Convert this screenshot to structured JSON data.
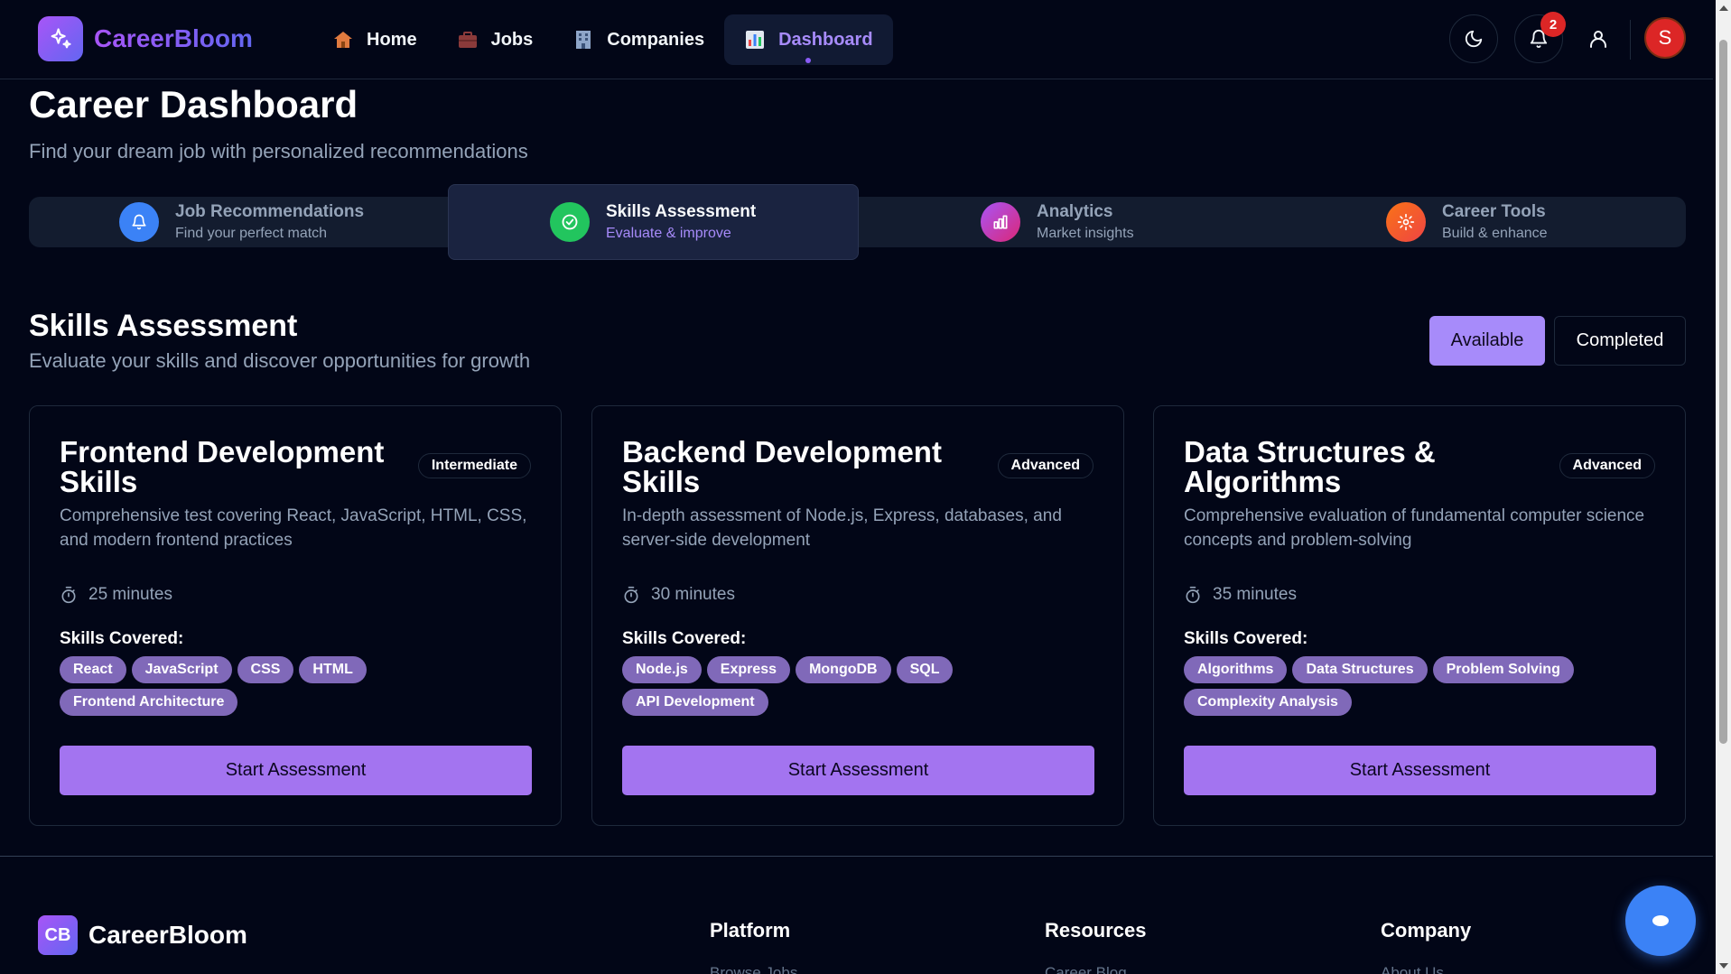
{
  "brand": {
    "name": "CareerBloom",
    "footer_initials": "CB"
  },
  "nav": {
    "links": [
      {
        "label": "Home",
        "icon": "house-emoji-icon"
      },
      {
        "label": "Jobs",
        "icon": "briefcase-emoji-icon"
      },
      {
        "label": "Companies",
        "icon": "office-building-emoji-icon"
      },
      {
        "label": "Dashboard",
        "icon": "bar-chart-emoji-icon",
        "active": true
      }
    ],
    "notification_count": "2",
    "avatar_initial": "S"
  },
  "header": {
    "title": "Career Dashboard",
    "subtitle": "Find your dream job with personalized recommendations"
  },
  "tabs": [
    {
      "title": "Job Recommendations",
      "desc": "Find your perfect match",
      "icon": "bell-icon",
      "color": "#3b82f6"
    },
    {
      "title": "Skills Assessment",
      "desc": "Evaluate & improve",
      "icon": "check-circle-icon",
      "color": "#22c55e",
      "active": true
    },
    {
      "title": "Analytics",
      "desc": "Market insights",
      "icon": "bar-chart-icon",
      "color": "#c026d3"
    },
    {
      "title": "Career Tools",
      "desc": "Build & enhance",
      "icon": "gear-icon",
      "color": "#f97316"
    }
  ],
  "section": {
    "title": "Skills Assessment",
    "subtitle": "Evaluate your skills and discover opportunities for growth",
    "filter_available": "Available",
    "filter_completed": "Completed"
  },
  "assessments": [
    {
      "title": "Frontend Development Skills",
      "level": "Intermediate",
      "desc": "Comprehensive test covering React, JavaScript, HTML, CSS, and modern frontend practices",
      "duration": "25 minutes",
      "skills_label": "Skills Covered:",
      "skills": [
        "React",
        "JavaScript",
        "CSS",
        "HTML",
        "Frontend Architecture"
      ],
      "button": "Start Assessment"
    },
    {
      "title": "Backend Development Skills",
      "level": "Advanced",
      "desc": "In-depth assessment of Node.js, Express, databases, and server-side development",
      "duration": "30 minutes",
      "skills_label": "Skills Covered:",
      "skills": [
        "Node.js",
        "Express",
        "MongoDB",
        "SQL",
        "API Development"
      ],
      "button": "Start Assessment"
    },
    {
      "title": "Data Structures & Algorithms",
      "level": "Advanced",
      "desc": "Comprehensive evaluation of fundamental computer science concepts and problem-solving",
      "duration": "35 minutes",
      "skills_label": "Skills Covered:",
      "skills": [
        "Algorithms",
        "Data Structures",
        "Problem Solving",
        "Complexity Analysis"
      ],
      "button": "Start Assessment"
    }
  ],
  "footer": {
    "headings": [
      "Platform",
      "Resources",
      "Company"
    ],
    "links": [
      "Browse Jobs",
      "Career Blog",
      "About Us"
    ]
  },
  "colors": {
    "accent": "#a78bfa",
    "button": "#a374f0",
    "tag": "#8069b9",
    "background": "#020617"
  }
}
